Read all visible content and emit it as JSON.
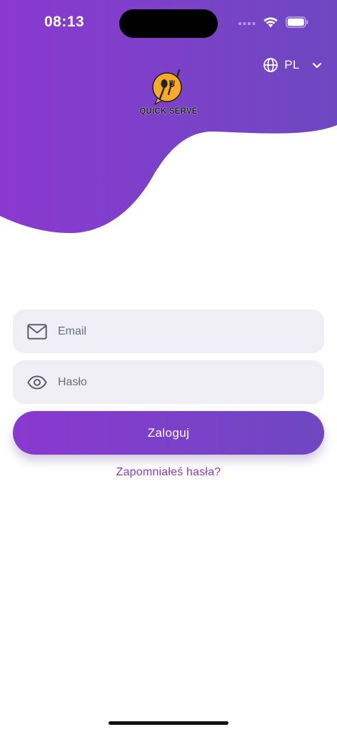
{
  "status_bar": {
    "time": "08:13",
    "signal_icon": "cellular-signal-icon",
    "wifi_icon": "wifi-icon",
    "battery_icon": "battery-icon"
  },
  "header": {
    "language": {
      "label": "PL",
      "globe_icon": "globe-icon",
      "chevron_icon": "chevron-down-icon"
    },
    "logo": {
      "text": "QUICK SERVE"
    }
  },
  "form": {
    "email": {
      "placeholder": "Email",
      "value": "",
      "icon": "envelope-icon"
    },
    "password": {
      "placeholder": "Hasło",
      "value": "",
      "icon": "eye-icon"
    },
    "login_label": "Zaloguj",
    "forgot_label": "Zapomniałeś hasła?"
  },
  "colors": {
    "gradient_start": "#8a39d0",
    "gradient_end": "#6e48c1",
    "link": "#8a3ac4",
    "field_background": "#efeff5",
    "logo_yellow": "#f7a927"
  }
}
